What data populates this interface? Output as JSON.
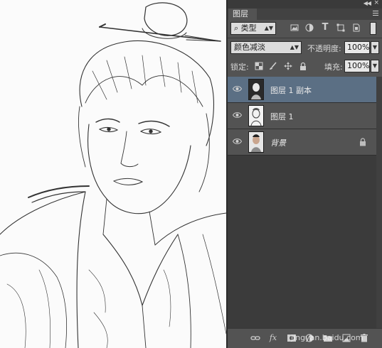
{
  "panel": {
    "tab_label": "图层",
    "filter": {
      "label": "⌕ 类型"
    },
    "blend_mode": "颜色减淡",
    "opacity_label": "不透明度:",
    "opacity_value": "100%",
    "lock_label": "锁定:",
    "fill_label": "填充:",
    "fill_value": "100%",
    "layers": [
      {
        "name": "图层 1 副本",
        "selected": true,
        "locked": false
      },
      {
        "name": "图层 1",
        "selected": false,
        "locked": false
      },
      {
        "name": "背景",
        "selected": false,
        "locked": true
      }
    ],
    "bottom_icons": [
      "link-icon",
      "fx-icon",
      "mask-icon",
      "adjustment-icon",
      "folder-icon",
      "new-layer-icon",
      "trash-icon"
    ],
    "fx_label": "fx",
    "watermark": "jingyan.baidu.com"
  },
  "colors": {
    "selection": "#5b6f84",
    "panel_bg": "#535353"
  }
}
